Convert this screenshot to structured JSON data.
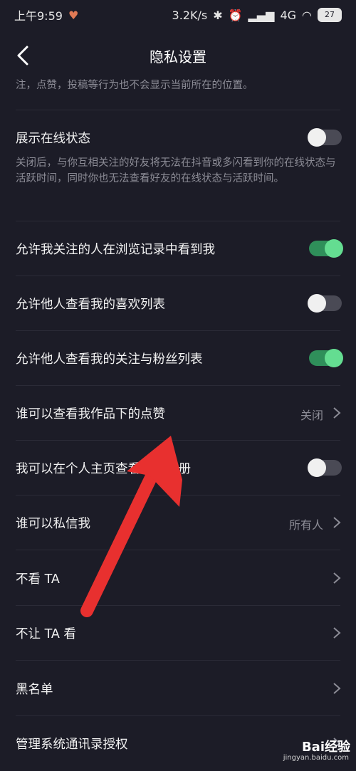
{
  "status_bar": {
    "time": "上午9:59",
    "speed": "3.2K/s",
    "network": "4G",
    "battery": "27"
  },
  "nav": {
    "title": "隐私设置"
  },
  "top_note": "注，点赞，投稿等行为也不会显示当前所在的位置。",
  "online_status": {
    "label": "展示在线状态",
    "description": "关闭后，与你互相关注的好友将无法在抖音或多闪看到你的在线状态与活跃时间，同时你也无法查看好友的在线状态与活跃时间。",
    "toggle_on": false
  },
  "rows": [
    {
      "label": "允许我关注的人在浏览记录中看到我",
      "type": "toggle",
      "on": true
    },
    {
      "label": "允许他人查看我的喜欢列表",
      "type": "toggle",
      "on": false
    },
    {
      "label": "允许他人查看我的关注与粉丝列表",
      "type": "toggle",
      "on": true
    },
    {
      "label": "谁可以查看我作品下的点赞",
      "type": "link",
      "value": "关闭"
    },
    {
      "label": "我可以在个人主页查看",
      "label_tail": "相册",
      "type": "toggle",
      "on": false
    },
    {
      "label": "谁可以私信我",
      "type": "link",
      "value": "所有人"
    },
    {
      "label": "不看 TA",
      "type": "link"
    },
    {
      "label": "不让 TA 看",
      "type": "link"
    },
    {
      "label": "黑名单",
      "type": "link"
    },
    {
      "label": "管理系统通讯录授权",
      "type": "link"
    }
  ],
  "watermark": {
    "main": "Bai经验",
    "sub": "jingyan.baidu.com"
  },
  "colors": {
    "accent_on": "#64dd91",
    "arrow": "#e8302f",
    "background": "#1c1c27"
  }
}
